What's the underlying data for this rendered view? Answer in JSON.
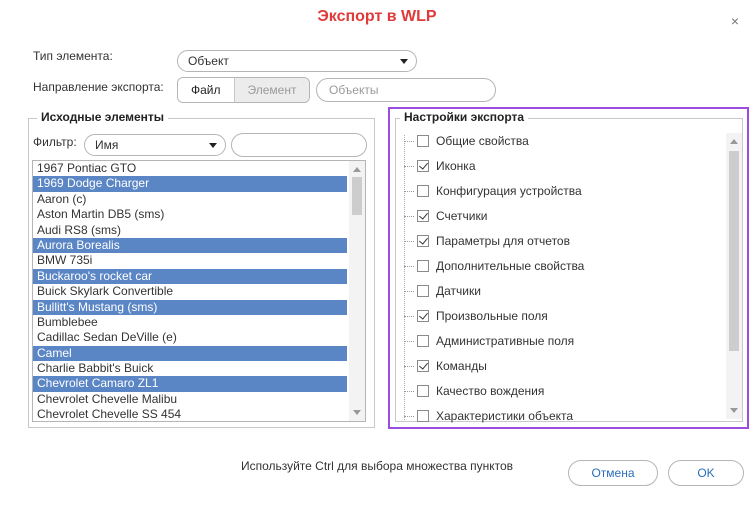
{
  "dialog": {
    "title": "Экспорт в WLP",
    "close_glyph": "×"
  },
  "form": {
    "type_label": "Тип элемента:",
    "type_value": "Объект",
    "direction_label": "Направление экспорта:",
    "seg_file": "Файл",
    "seg_element": "Элемент",
    "objects_placeholder": "Объекты"
  },
  "source": {
    "title": "Исходные элементы",
    "filter_label": "Фильтр:",
    "filter_value": "Имя",
    "search_value": "",
    "items": [
      {
        "label": "1967 Pontiac GTO",
        "selected": false
      },
      {
        "label": "1969 Dodge Charger",
        "selected": true
      },
      {
        "label": "Aaron (c)",
        "selected": false
      },
      {
        "label": "Aston Martin DB5 (sms)",
        "selected": false
      },
      {
        "label": "Audi RS8 (sms)",
        "selected": false
      },
      {
        "label": "Aurora Borealis",
        "selected": true
      },
      {
        "label": "BMW 735i",
        "selected": false
      },
      {
        "label": "Buckaroo's rocket car",
        "selected": true
      },
      {
        "label": "Buick Skylark Convertible",
        "selected": false
      },
      {
        "label": "Bullitt's Mustang (sms)",
        "selected": true
      },
      {
        "label": "Bumblebee",
        "selected": false
      },
      {
        "label": "Cadillac Sedan DeVille (e)",
        "selected": false
      },
      {
        "label": "Camel",
        "selected": true
      },
      {
        "label": "Charlie Babbit's Buick",
        "selected": false
      },
      {
        "label": "Chevrolet Camaro ZL1",
        "selected": true
      },
      {
        "label": "Chevrolet Chevelle Malibu",
        "selected": false
      },
      {
        "label": "Chevrolet Chevelle SS 454",
        "selected": false
      }
    ]
  },
  "settings": {
    "title": "Настройки экспорта",
    "items": [
      {
        "label": "Общие свойства",
        "checked": false
      },
      {
        "label": "Иконка",
        "checked": true
      },
      {
        "label": "Конфигурация устройства",
        "checked": false
      },
      {
        "label": "Счетчики",
        "checked": true
      },
      {
        "label": "Параметры для отчетов",
        "checked": true
      },
      {
        "label": "Дополнительные свойства",
        "checked": false
      },
      {
        "label": "Датчики",
        "checked": false
      },
      {
        "label": "Произвольные поля",
        "checked": true
      },
      {
        "label": "Административные поля",
        "checked": false
      },
      {
        "label": "Команды",
        "checked": true
      },
      {
        "label": "Качество вождения",
        "checked": false
      },
      {
        "label": "Характеристики объекта",
        "checked": false
      }
    ]
  },
  "footer": {
    "hint": "Используйте Ctrl для выбора множества пунктов",
    "cancel": "Отмена",
    "ok": "OK"
  },
  "colors": {
    "title": "#e03a3a",
    "selection": "#5b86c5",
    "focus_border": "#9b4de0",
    "button_text": "#2a6ebb"
  }
}
